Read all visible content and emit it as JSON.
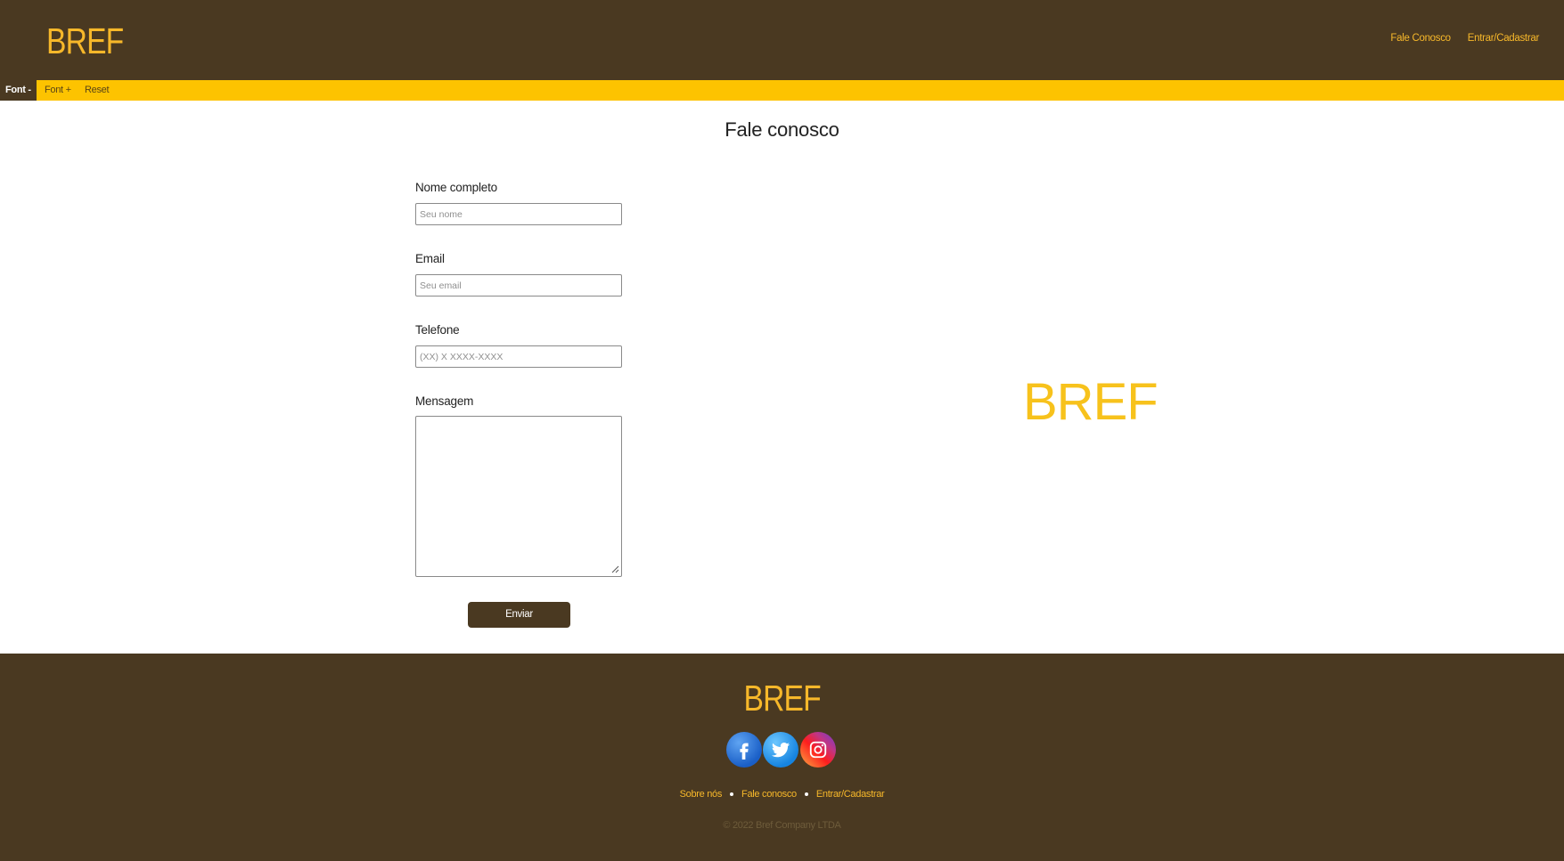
{
  "header": {
    "logo": "BREF",
    "nav": [
      "Fale Conosco",
      "Entrar/Cadastrar"
    ]
  },
  "font_bar": {
    "decrease_label": "Font -",
    "increase_label": "Font +",
    "reset_label": "Reset"
  },
  "main": {
    "title": "Fale conosco",
    "form": {
      "name_label": "Nome completo",
      "name_placeholder": "Seu nome",
      "email_label": "Email",
      "email_placeholder": "Seu email",
      "phone_label": "Telefone",
      "phone_placeholder": "(XX) X XXXX-XXXX",
      "message_label": "Mensagem",
      "message_value": "",
      "submit_label": "Enviar"
    },
    "side_logo": "BREF"
  },
  "footer": {
    "logo": "BREF",
    "social_icons": [
      "facebook-icon",
      "twitter-icon",
      "instagram-icon"
    ],
    "links": [
      "Sobre nós",
      "Fale conosco",
      "Entrar/Cadastrar"
    ],
    "copyright": "© 2022 Bref Company LTDA"
  },
  "colors": {
    "brown": "#4a3921",
    "gold": "#f7b82a",
    "yellow_bar": "#fdc300"
  }
}
